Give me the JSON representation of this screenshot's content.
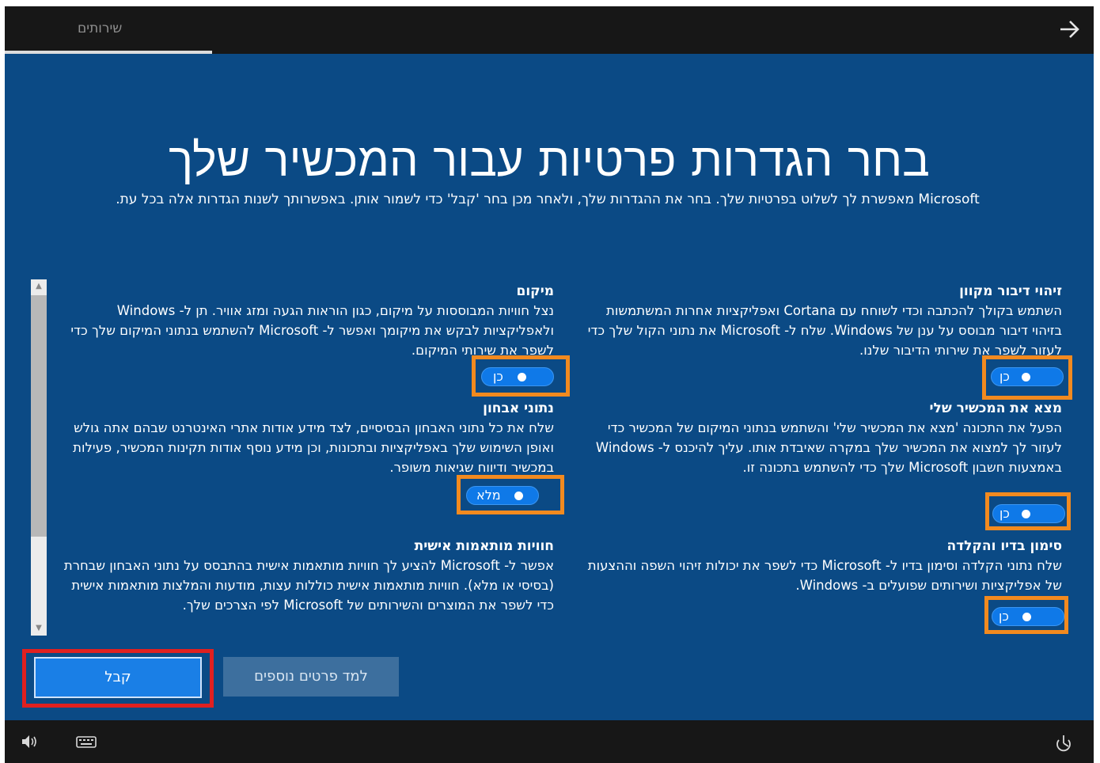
{
  "topbar": {
    "tab_label": "שירותים",
    "forward_icon": "arrow-right-icon"
  },
  "page": {
    "title": "בחר הגדרות פרטיות עבור המכשיר שלך",
    "subtitle": "Microsoft מאפשרת לך לשלוט בפרטיות שלך. בחר את ההגדרות שלך, ולאחר מכן בחר 'קבל' כדי לשמור אותן. באפשרותך לשנות הגדרות אלה בכל עת."
  },
  "settings": {
    "speech": {
      "title": "זיהוי דיבור מקוון",
      "desc": "השתמש בקולך להכתבה וכדי לשוחח עם Cortana ואפליקציות אחרות המשתמשות בזיהוי דיבור מבוסס על ענן של Windows. שלח ל- Microsoft את נתוני הקול שלך כדי לעזור לשפר את שירותי הדיבור שלנו.",
      "toggle_label": "כן",
      "toggle_on": true
    },
    "location": {
      "title": "מיקום",
      "desc": "נצל חוויות המבוססות על מיקום, כגון הוראות הגעה ומזג אוויר. תן ל- Windows ולאפליקציות לבקש את מיקומך ואפשר ל- Microsoft להשתמש בנתוני המיקום שלך כדי לשפר את שירותי המיקום.",
      "toggle_label": "כן",
      "toggle_on": true
    },
    "find_device": {
      "title": "מצא את המכשיר שלי",
      "desc": "הפעל את התכונה 'מצא את המכשיר שלי' והשתמש בנתוני המיקום של המכשיר כדי לעזור לך למצוא את המכשיר שלך במקרה שאיבדת אותו. עליך להיכנס ל- Windows באמצעות חשבון Microsoft שלך כדי להשתמש בתכונה זו.",
      "toggle_label": "כן",
      "toggle_on": true
    },
    "diagnostics": {
      "title": "נתוני אבחון",
      "desc": "שלח את כל נתוני האבחון הבסיסיים, לצד מידע אודות אתרי האינטרנט שבהם אתה גולש ואופן השימוש שלך באפליקציות ובתכונות, וכן מידע נוסף אודות תקינות המכשיר, פעילות במכשיר ודיווח שגיאות משופר.",
      "toggle_label": "מלא",
      "toggle_on": true
    },
    "inking": {
      "title": "סימון בדיו והקלדה",
      "desc": "שלח נתוני הקלדה וסימון בדיו ל- Microsoft כדי לשפר את יכולות זיהוי השפה וההצעות של אפליקציות ושירותים שפועלים ב- Windows.",
      "toggle_label": "כן",
      "toggle_on": true
    },
    "tailored": {
      "title": "חוויות מותאמות אישית",
      "desc": "אפשר ל- Microsoft להציע לך חוויות מותאמות אישית בהתבסס על נתוני האבחון שבחרת (בסיסי או מלא). חוויות מותאמות אישית כוללות עצות, מודעות והמלצות מותאמות אישית כדי לשפר את המוצרים והשירותים של Microsoft לפי הצרכים שלך."
    }
  },
  "buttons": {
    "accept": "קבל",
    "learn_more": "למד פרטים נוספים"
  },
  "bottombar": {
    "icons": [
      "volume-icon",
      "keyboard-icon",
      "ease-of-access-icon"
    ]
  },
  "colors": {
    "background": "#0b4a85",
    "highlight_orange": "#f28a1f",
    "highlight_red": "#e02020",
    "toggle_on": "#0f79e8"
  }
}
